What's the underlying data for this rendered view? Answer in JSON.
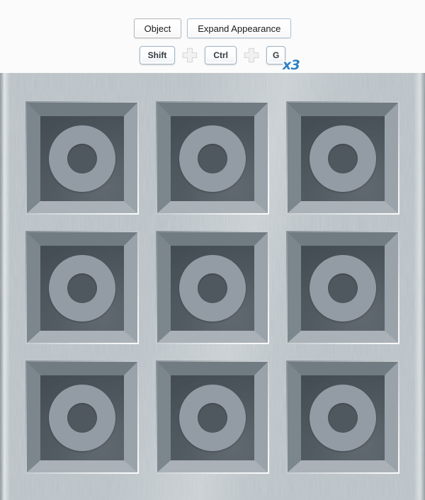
{
  "command_area": {
    "menu_row": {
      "items": [
        {
          "label": "Object",
          "accent": false
        },
        {
          "label": "Expand Appearance",
          "accent": true
        }
      ]
    },
    "shortcut_row": {
      "keys": [
        {
          "label": "Shift",
          "narrow": false
        },
        {
          "label": "Ctrl",
          "narrow": false
        },
        {
          "label": "G",
          "narrow": true
        }
      ],
      "separator_icon": "plus-icon",
      "repeat_badge": "x3",
      "repeat_badge_color": "#2f80c4"
    }
  },
  "artwork": {
    "title": "brushed metal plate with nine recessed square wells",
    "grid": {
      "rows": 3,
      "columns": 3,
      "cell_count": 9
    },
    "colors": {
      "plate_light": "#e9edef",
      "plate_mid": "#c3cace",
      "plate_edge_dark": "#8e969b",
      "well_interior": "#495258",
      "well_wall_shadow": "#707b82",
      "well_wall_light": "#aab2b8",
      "ring_fill": "#939ca5",
      "ring_center": "#4f585e"
    },
    "cells": [
      {
        "index": 1,
        "shape": "ring"
      },
      {
        "index": 2,
        "shape": "ring"
      },
      {
        "index": 3,
        "shape": "ring"
      },
      {
        "index": 4,
        "shape": "ring"
      },
      {
        "index": 5,
        "shape": "ring"
      },
      {
        "index": 6,
        "shape": "ring"
      },
      {
        "index": 7,
        "shape": "ring"
      },
      {
        "index": 8,
        "shape": "ring"
      },
      {
        "index": 9,
        "shape": "ring"
      }
    ]
  }
}
